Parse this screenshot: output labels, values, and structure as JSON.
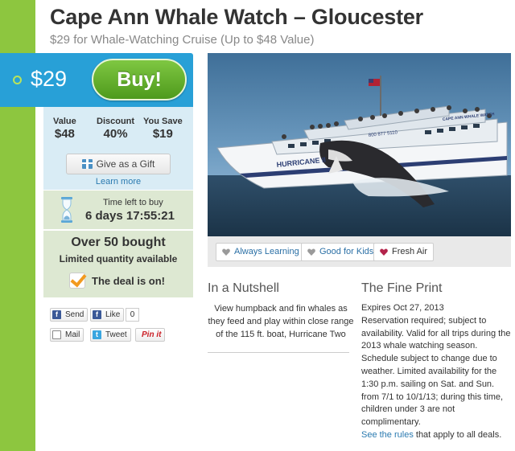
{
  "deal": {
    "title": "Cape Ann Whale Watch – Gloucester",
    "subtitle": "$29 for Whale-Watching Cruise (Up to $48 Value)"
  },
  "purchase": {
    "price": "$29",
    "buy_label": "Buy!"
  },
  "value": {
    "value_label": "Value",
    "value_amount": "$48",
    "discount_label": "Discount",
    "discount_amount": "40%",
    "save_label": "You Save",
    "save_amount": "$19",
    "gift_label": "Give as a Gift",
    "learn_more": "Learn more"
  },
  "timer": {
    "label": "Time left to buy",
    "value": "6 days 17:55:21"
  },
  "bought": {
    "title": "Over 50 bought",
    "subtitle": "Limited quantity available",
    "status": "The deal is on!"
  },
  "social": {
    "send": "Send",
    "like": "Like",
    "like_count": "0",
    "mail": "Mail",
    "tweet": "Tweet",
    "pin": "Pin it"
  },
  "tags": [
    {
      "label": "Always Learning",
      "color": "#9a9a9a"
    },
    {
      "label": "Good for Kids",
      "color": "#9a9a9a"
    },
    {
      "label": "Fresh Air",
      "color": "#b3244b"
    }
  ],
  "nutshell": {
    "heading": "In a Nutshell",
    "text": "View humpback and fin whales as they feed and play within close range of the 115 ft. boat, Hurricane Two"
  },
  "fine_print": {
    "heading": "The Fine Print",
    "expires": "Expires Oct 27, 2013",
    "text": "Reservation required; subject to availability. Valid for all trips during the 2013 whale watching season. Schedule subject to change due to weather. Limited availability for the 1:30 p.m. sailing on Sat. and Sun. from 7/1 to 10/1/13; during this time, children under 3 are not complimentary.",
    "rules_link": "See the rules",
    "rules_suffix": " that apply to all deals."
  },
  "photo": {
    "boat_name": "HURRICANE II",
    "boat_phone": "800 877 5110",
    "boat_sign": "CAPE ANN WHALE WATCH"
  },
  "colors": {
    "accent_green": "#8dc63f",
    "price_blue": "#28a0d7",
    "link_blue": "#2a7ab0"
  }
}
